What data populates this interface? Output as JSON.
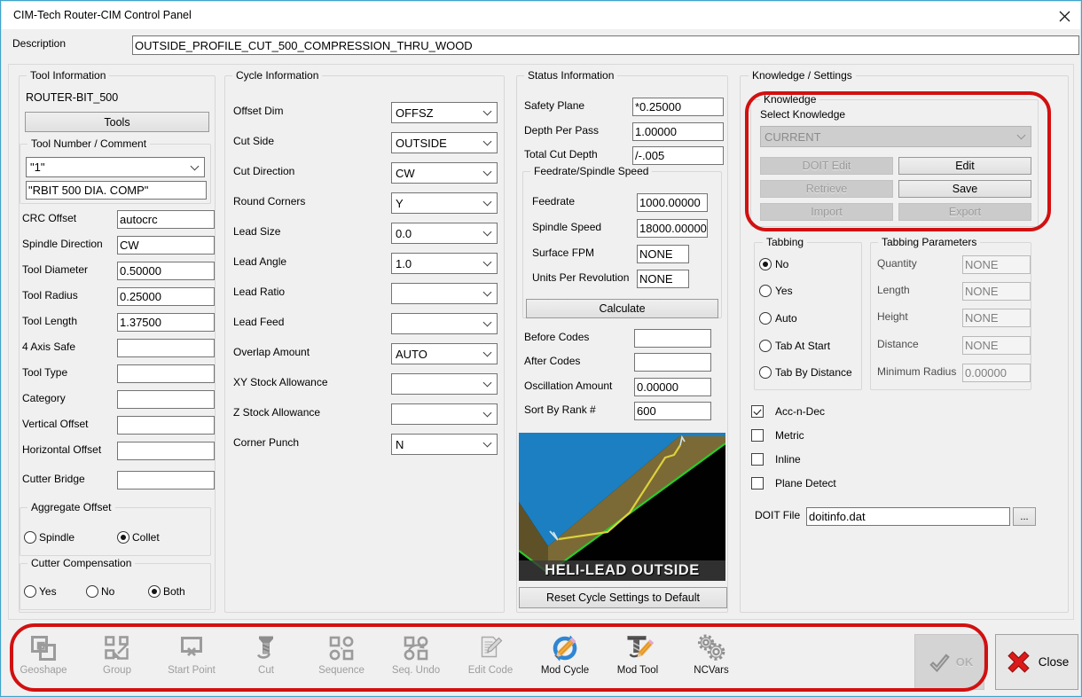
{
  "window": {
    "title": "CIM-Tech Router-CIM Control Panel"
  },
  "description": {
    "label": "Description",
    "value": "OUTSIDE_PROFILE_CUT_500_COMPRESSION_THRU_WOOD"
  },
  "tool_info": {
    "title": "Tool Information",
    "tool_name": "ROUTER-BIT_500",
    "tools_button": "Tools",
    "tool_number": {
      "title": "Tool Number / Comment",
      "number": "\"1\"",
      "comment": "\"RBIT 500 DIA. COMP\""
    },
    "fields": [
      {
        "label": "CRC Offset",
        "value": "autocrc"
      },
      {
        "label": "Spindle Direction",
        "value": "CW"
      },
      {
        "label": "Tool Diameter",
        "value": "0.50000"
      },
      {
        "label": "Tool Radius",
        "value": "0.25000"
      },
      {
        "label": "Tool Length",
        "value": "1.37500"
      },
      {
        "label": "4 Axis Safe",
        "value": ""
      },
      {
        "label": "Tool Type",
        "value": ""
      },
      {
        "label": "Category",
        "value": ""
      },
      {
        "label": "Vertical Offset",
        "value": ""
      },
      {
        "label": "Horizontal Offset",
        "value": ""
      },
      {
        "label": "Cutter Bridge",
        "value": ""
      }
    ],
    "aggregate_offset": {
      "title": "Aggregate Offset",
      "options": [
        {
          "label": "Spindle",
          "selected": false
        },
        {
          "label": "Collet",
          "selected": true
        }
      ]
    },
    "cutter_compensation": {
      "title": "Cutter Compensation",
      "options": [
        {
          "label": "Yes",
          "selected": false
        },
        {
          "label": "No",
          "selected": false
        },
        {
          "label": "Both",
          "selected": true
        }
      ]
    }
  },
  "cycle_info": {
    "title": "Cycle Information",
    "fields": [
      {
        "label": "Offset Dim",
        "value": "OFFSZ"
      },
      {
        "label": "Cut Side",
        "value": "OUTSIDE"
      },
      {
        "label": "Cut Direction",
        "value": "CW"
      },
      {
        "label": "Round Corners",
        "value": "Y"
      },
      {
        "label": "Lead Size",
        "value": "0.0"
      },
      {
        "label": "Lead Angle",
        "value": "1.0"
      },
      {
        "label": "Lead Ratio",
        "value": ""
      },
      {
        "label": "Lead Feed",
        "value": ""
      },
      {
        "label": "Overlap Amount",
        "value": "AUTO"
      },
      {
        "label": "XY Stock Allowance",
        "value": ""
      },
      {
        "label": "Z Stock Allowance",
        "value": ""
      },
      {
        "label": "Corner Punch",
        "value": "N"
      }
    ]
  },
  "status_info": {
    "title": "Status Information",
    "fields_top": [
      {
        "label": "Safety Plane",
        "value": "*0.25000"
      },
      {
        "label": "Depth Per Pass",
        "value": "1.00000"
      },
      {
        "label": "Total Cut Depth",
        "value": "/-.005"
      }
    ],
    "feedrate_group": {
      "title": "Feedrate/Spindle Speed",
      "fields": [
        {
          "label": "Feedrate",
          "value": "1000.00000"
        },
        {
          "label": "Spindle Speed",
          "value": "18000.00000"
        },
        {
          "label": "Surface FPM",
          "value": "NONE"
        },
        {
          "label": "Units Per Revolution",
          "value": "NONE"
        }
      ],
      "calculate_button": "Calculate"
    },
    "fields_bottom": [
      {
        "label": "Before Codes",
        "value": ""
      },
      {
        "label": "After Codes",
        "value": ""
      },
      {
        "label": "Oscillation Amount",
        "value": "0.00000"
      },
      {
        "label": "Sort By Rank #",
        "value": "600"
      }
    ],
    "preview_caption": "HELI-LEAD OUTSIDE",
    "reset_button": "Reset Cycle Settings to Default"
  },
  "knowledge_settings": {
    "title": "Knowledge / Settings",
    "knowledge": {
      "title": "Knowledge",
      "select_label": "Select Knowledge",
      "selected_value": "CURRENT",
      "buttons": [
        {
          "label": "DOIT Edit",
          "enabled": false
        },
        {
          "label": "Edit",
          "enabled": true
        },
        {
          "label": "Retrieve",
          "enabled": false
        },
        {
          "label": "Save",
          "enabled": true
        },
        {
          "label": "Import",
          "enabled": false
        },
        {
          "label": "Export",
          "enabled": false
        }
      ]
    },
    "tabbing": {
      "title": "Tabbing",
      "options": [
        {
          "label": "No",
          "selected": true
        },
        {
          "label": "Yes",
          "selected": false
        },
        {
          "label": "Auto",
          "selected": false
        },
        {
          "label": "Tab At Start",
          "selected": false
        },
        {
          "label": "Tab By Distance",
          "selected": false
        }
      ]
    },
    "tabbing_parameters": {
      "title": "Tabbing Parameters",
      "fields": [
        {
          "label": "Quantity",
          "value": "NONE"
        },
        {
          "label": "Length",
          "value": "NONE"
        },
        {
          "label": "Height",
          "value": "NONE"
        },
        {
          "label": "Distance",
          "value": "NONE"
        },
        {
          "label": "Minimum Radius",
          "value": "0.00000"
        }
      ]
    },
    "checkboxes": [
      {
        "label": "Acc-n-Dec",
        "checked": true
      },
      {
        "label": "Metric",
        "checked": false
      },
      {
        "label": "Inline",
        "checked": false
      },
      {
        "label": "Plane Detect",
        "checked": false
      }
    ],
    "doit_file": {
      "label": "DOIT File",
      "value": "doitinfo.dat",
      "browse_button": "..."
    }
  },
  "toolbar": {
    "items": [
      {
        "label": "Geoshape",
        "enabled": false
      },
      {
        "label": "Group",
        "enabled": false
      },
      {
        "label": "Start Point",
        "enabled": false
      },
      {
        "label": "Cut",
        "enabled": false
      },
      {
        "label": "Sequence",
        "enabled": false
      },
      {
        "label": "Seq. Undo",
        "enabled": false
      },
      {
        "label": "Edit Code",
        "enabled": false
      },
      {
        "label": "Mod Cycle",
        "enabled": true
      },
      {
        "label": "Mod Tool",
        "enabled": true
      },
      {
        "label": "NCVars",
        "enabled": true
      }
    ],
    "ok_button": "OK",
    "close_button": "Close"
  },
  "annotations": {
    "color": "#d21010",
    "highlighted": [
      "knowledge-group",
      "toolbar-with-ok"
    ]
  }
}
